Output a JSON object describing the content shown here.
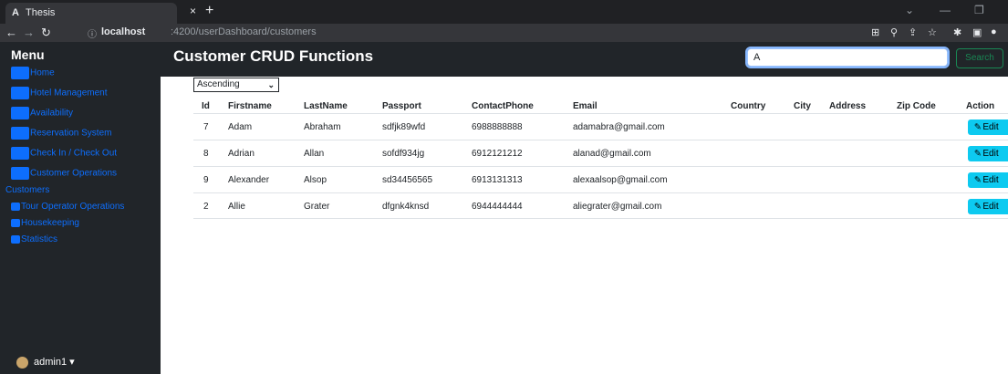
{
  "browser": {
    "tab_title": "Thesis",
    "tab_icon": "A",
    "tab_close": "×",
    "new_tab": "+",
    "url_info": "ⓘ",
    "url_host": "localhost",
    "url_path": ":4200/userDashboard/customers"
  },
  "sidebar": {
    "title": "Menu",
    "items": [
      {
        "label": "Home"
      },
      {
        "label": "Hotel Management"
      },
      {
        "label": "Availability"
      },
      {
        "label": "Reservation System"
      },
      {
        "label": "Check In / Check Out"
      },
      {
        "label": "Customer Operations"
      },
      {
        "label": "Customers"
      },
      {
        "label": "Tour Operator Operations"
      },
      {
        "label": "Housekeeping"
      },
      {
        "label": "Statistics"
      }
    ],
    "user": "admin1 ▾"
  },
  "header": {
    "title": "Customer CRUD Functions",
    "search_value": "A",
    "search_button": "Search"
  },
  "sort": {
    "selected": "Ascending"
  },
  "table": {
    "columns": [
      "Id",
      "Firstname",
      "LastName",
      "Passport",
      "ContactPhone",
      "Email",
      "Country",
      "City",
      "Address",
      "Zip Code",
      "Action"
    ],
    "rows": [
      {
        "id": "7",
        "first": "Adam",
        "last": "Abraham",
        "passport": "sdfjk89wfd",
        "phone": "6988888888",
        "email": "adamabra@gmail.com",
        "action": "Edit"
      },
      {
        "id": "8",
        "first": "Adrian",
        "last": "Allan",
        "passport": "sofdf934jg",
        "phone": "6912121212",
        "email": "alanad@gmail.com",
        "action": "Edit"
      },
      {
        "id": "9",
        "first": "Alexander",
        "last": "Alsop",
        "passport": "sd34456565",
        "phone": "6913131313",
        "email": "alexaalsop@gmail.com",
        "action": "Edit"
      },
      {
        "id": "2",
        "first": "Allie",
        "last": "Grater",
        "passport": "dfgnk4knsd",
        "phone": "6944444444",
        "email": "aliegrater@gmail.com",
        "action": "Edit"
      }
    ]
  },
  "colors": {
    "sidebar_bg": "#212529",
    "link_blue": "#0d6efd",
    "edit_button": "#0dcaf0",
    "search_border": "#198754"
  }
}
